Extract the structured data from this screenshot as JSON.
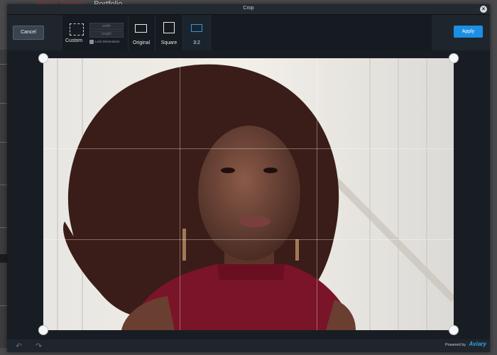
{
  "background": {
    "nav": [
      "Venue Gallery",
      "Portfolio"
    ]
  },
  "modal": {
    "title": "Crop",
    "close_glyph": "×",
    "toolbar": {
      "cancel": "Cancel",
      "custom": {
        "label": "Custom",
        "width_placeholder": "width",
        "height_placeholder": "height",
        "lock": "Lock Dimensions"
      },
      "presets": [
        {
          "label": "Original",
          "icon": "original-ratio-icon"
        },
        {
          "label": "Square",
          "icon": "square-ratio-icon"
        },
        {
          "label": "3:2",
          "icon": "ratio-3-2-icon",
          "selected": true
        }
      ],
      "apply": "Apply"
    },
    "footer": {
      "undo_glyph": "↶",
      "redo_glyph": "↷",
      "powered_by": "Powered by",
      "brand": "Aviary"
    }
  },
  "colors": {
    "accent": "#1a8fe3",
    "selected_preset": "#2f9ae0",
    "modal_bg": "#1a1f25"
  }
}
